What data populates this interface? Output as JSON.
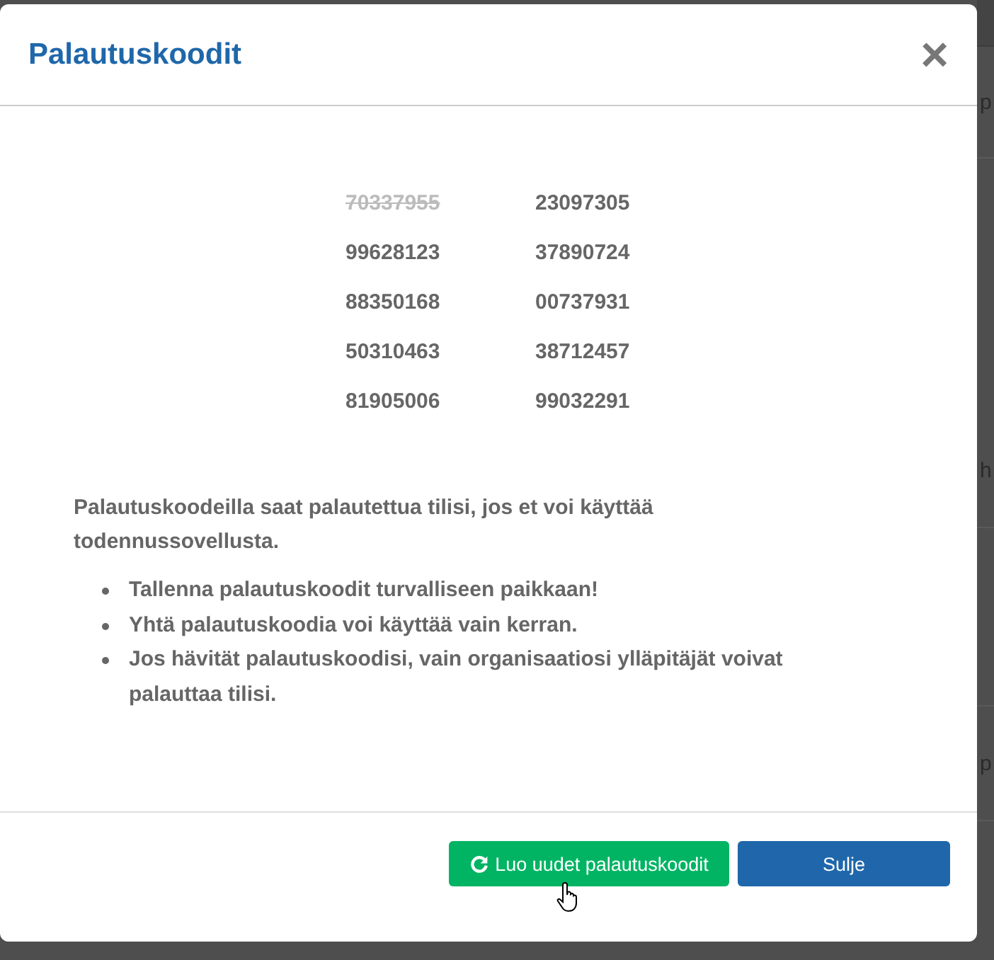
{
  "dialog": {
    "title": "Palautuskoodit",
    "close": "×"
  },
  "codes": [
    {
      "code": "70337955",
      "used": true
    },
    {
      "code": "23097305",
      "used": false
    },
    {
      "code": "99628123",
      "used": false
    },
    {
      "code": "37890724",
      "used": false
    },
    {
      "code": "88350168",
      "used": false
    },
    {
      "code": "00737931",
      "used": false
    },
    {
      "code": "50310463",
      "used": false
    },
    {
      "code": "38712457",
      "used": false
    },
    {
      "code": "81905006",
      "used": false
    },
    {
      "code": "99032291",
      "used": false
    }
  ],
  "description": "Palautuskoodeilla saat palautettua tilisi, jos et voi käyttää todennussovellusta.",
  "notes": [
    "Tallenna palautuskoodit turvalliseen paikkaan!",
    "Yhtä palautuskoodia voi käyttää vain kerran.",
    "Jos hävität palautuskoodisi, vain organisaatiosi ylläpitäjät voivat palauttaa tilisi."
  ],
  "buttons": [
    {
      "label": "Luo uudet palautuskoodit",
      "kind": "regenerate"
    },
    {
      "label": "Sulje",
      "kind": "close"
    }
  ],
  "background_fragments": [
    "p",
    "h",
    "p"
  ]
}
